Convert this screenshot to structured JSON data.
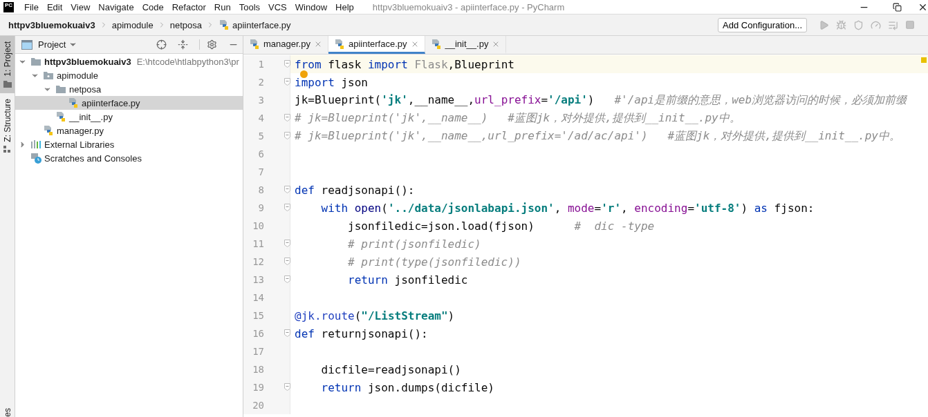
{
  "window": {
    "logo": "PC",
    "title": "httpv3bluemokuaiv3 - apiinterface.py - PyCharm"
  },
  "menu": [
    "File",
    "Edit",
    "View",
    "Navigate",
    "Code",
    "Refactor",
    "Run",
    "Tools",
    "VCS",
    "Window",
    "Help"
  ],
  "breadcrumbs": [
    {
      "label": "httpv3bluemokuaiv3",
      "kind": "project"
    },
    {
      "label": "apimodule",
      "kind": "folder"
    },
    {
      "label": "netposa",
      "kind": "folder"
    },
    {
      "label": "apiinterface.py",
      "kind": "file"
    }
  ],
  "toolbar": {
    "run_config": "Add Configuration..."
  },
  "tool_windows": [
    {
      "label": "1: Project",
      "selected": true,
      "kind": "project"
    },
    {
      "label": "Z: Structure",
      "selected": false,
      "kind": "structure"
    }
  ],
  "tool_windows_bottom": [
    {
      "label": "es",
      "selected": false
    }
  ],
  "project_panel": {
    "title": "Project",
    "tree": [
      {
        "label": "httpv3bluemokuaiv3",
        "path": "E:\\htcode\\htlabpython3\\pr",
        "kind": "root",
        "expanded": true,
        "selected": false,
        "children": [
          {
            "label": "apimodule",
            "kind": "package",
            "expanded": true,
            "selected": false,
            "children": [
              {
                "label": "netposa",
                "kind": "folder",
                "expanded": true,
                "selected": false,
                "children": [
                  {
                    "label": "apiinterface.py",
                    "kind": "python",
                    "selected": true
                  }
                ]
              },
              {
                "label": "__init__.py",
                "kind": "python",
                "selected": false
              }
            ]
          },
          {
            "label": "manager.py",
            "kind": "python",
            "selected": false
          }
        ]
      },
      {
        "label": "External Libraries",
        "kind": "libraries",
        "expanded": false,
        "selected": false
      },
      {
        "label": "Scratches and Consoles",
        "kind": "scratches",
        "selected": false
      }
    ]
  },
  "editor": {
    "tabs": [
      {
        "label": "manager.py",
        "selected": false
      },
      {
        "label": "apiinterface.py",
        "selected": true
      },
      {
        "label": "__init__.py",
        "selected": false
      }
    ],
    "lines": [
      {
        "number": "1",
        "current": true,
        "fold": true,
        "bulb": false,
        "tokens": [
          {
            "kind": "kw",
            "text": "from"
          },
          {
            "kind": "plain",
            "text": " flask "
          },
          {
            "kind": "kw",
            "text": "import "
          },
          {
            "kind": "unused",
            "text": "Flask"
          },
          {
            "kind": "plain",
            "text": ",Blueprint"
          }
        ]
      },
      {
        "number": "2",
        "current": false,
        "fold": true,
        "bulb": true,
        "tokens": [
          {
            "kind": "kw",
            "text": "import"
          },
          {
            "kind": "plain",
            "text": " json"
          }
        ]
      },
      {
        "number": "3",
        "current": false,
        "fold": false,
        "bulb": false,
        "tokens": [
          {
            "kind": "plain",
            "text": "jk=Blueprint("
          },
          {
            "kind": "str",
            "text": "'jk'"
          },
          {
            "kind": "plain",
            "text": ",__name__,"
          },
          {
            "kind": "param",
            "text": "url_prefix"
          },
          {
            "kind": "plain",
            "text": "="
          },
          {
            "kind": "str",
            "text": "'/api'"
          },
          {
            "kind": "plain",
            "text": ")   "
          },
          {
            "kind": "comment",
            "text": "#'/api是前缀的意思，web浏览器访问的时候，必须加前缀"
          }
        ]
      },
      {
        "number": "4",
        "current": false,
        "fold": true,
        "bulb": false,
        "tokens": [
          {
            "kind": "comment",
            "text": "# jk=Blueprint('jk',__name__)   #蓝图jk，对外提供,提供到__init__.py中。"
          }
        ]
      },
      {
        "number": "5",
        "current": false,
        "fold": true,
        "bulb": false,
        "tokens": [
          {
            "kind": "comment",
            "text": "# jk=Blueprint('jk',__name__,url_prefix='/ad/ac/api')   #蓝图jk，对外提供,提供到__init__.py中。"
          }
        ]
      },
      {
        "number": "6",
        "current": false,
        "fold": false,
        "bulb": false
      },
      {
        "number": "7",
        "current": false,
        "fold": false,
        "bulb": false
      },
      {
        "number": "8",
        "current": false,
        "fold": true,
        "bulb": false,
        "tokens": [
          {
            "kind": "kw",
            "text": "def"
          },
          {
            "kind": "plain",
            "text": " readjsonapi():"
          }
        ],
        "children": [
          {
            "number": "9",
            "current": false,
            "fold": true,
            "bulb": false,
            "tokens": [
              {
                "kind": "kw",
                "text": "with "
              },
              {
                "kind": "builtin",
                "text": "open"
              },
              {
                "kind": "plain",
                "text": "("
              },
              {
                "kind": "str",
                "text": "'../data/jsonlabapi.json'"
              },
              {
                "kind": "plain",
                "text": ", "
              },
              {
                "kind": "param",
                "text": "mode"
              },
              {
                "kind": "plain",
                "text": "="
              },
              {
                "kind": "str",
                "text": "'r'"
              },
              {
                "kind": "plain",
                "text": ", "
              },
              {
                "kind": "param",
                "text": "encoding"
              },
              {
                "kind": "plain",
                "text": "="
              },
              {
                "kind": "str",
                "text": "'utf-8'"
              },
              {
                "kind": "plain",
                "text": ") "
              },
              {
                "kind": "kw",
                "text": "as"
              },
              {
                "kind": "plain",
                "text": " fjson:"
              }
            ],
            "children": [
              {
                "number": "10",
                "current": false,
                "fold": false,
                "bulb": false,
                "tokens": [
                  {
                    "kind": "plain",
                    "text": "jsonfiledic=json.load(fjson)      "
                  },
                  {
                    "kind": "comment",
                    "text": "#  dic -type"
                  }
                ]
              },
              {
                "number": "11",
                "current": false,
                "fold": true,
                "bulb": false,
                "tokens": [
                  {
                    "kind": "comment",
                    "text": "# print(jsonfiledic)"
                  }
                ]
              },
              {
                "number": "12",
                "current": false,
                "fold": true,
                "bulb": false,
                "tokens": [
                  {
                    "kind": "comment",
                    "text": "# print(type(jsonfiledic))"
                  }
                ]
              },
              {
                "number": "13",
                "current": false,
                "fold": true,
                "bulb": false,
                "tokens": [
                  {
                    "kind": "kw",
                    "text": "return"
                  },
                  {
                    "kind": "plain",
                    "text": " jsonfiledic"
                  }
                ]
              }
            ]
          }
        ]
      },
      {
        "number": "14",
        "current": false,
        "fold": false,
        "bulb": false
      },
      {
        "number": "15",
        "current": false,
        "fold": false,
        "bulb": false,
        "tokens": [
          {
            "kind": "deco",
            "text": "@jk.route"
          },
          {
            "kind": "plain",
            "text": "("
          },
          {
            "kind": "str",
            "text": "\"/ListStream\""
          },
          {
            "kind": "plain",
            "text": ")"
          }
        ]
      },
      {
        "number": "16",
        "current": false,
        "fold": true,
        "bulb": false,
        "tokens": [
          {
            "kind": "kw",
            "text": "def"
          },
          {
            "kind": "plain",
            "text": " returnjsonapi():"
          }
        ],
        "children": [
          {
            "number": "17",
            "current": false,
            "fold": false,
            "bulb": false
          },
          {
            "number": "18",
            "current": false,
            "fold": false,
            "bulb": false,
            "tokens": [
              {
                "kind": "plain",
                "text": "dicfile=readjsonapi()"
              }
            ]
          },
          {
            "number": "19",
            "current": false,
            "fold": true,
            "bulb": false,
            "tokens": [
              {
                "kind": "kw",
                "text": "return"
              },
              {
                "kind": "plain",
                "text": " json.dumps(dicfile)"
              }
            ]
          }
        ]
      },
      {
        "number": "20",
        "current": false,
        "fold": false,
        "bulb": false
      }
    ]
  }
}
